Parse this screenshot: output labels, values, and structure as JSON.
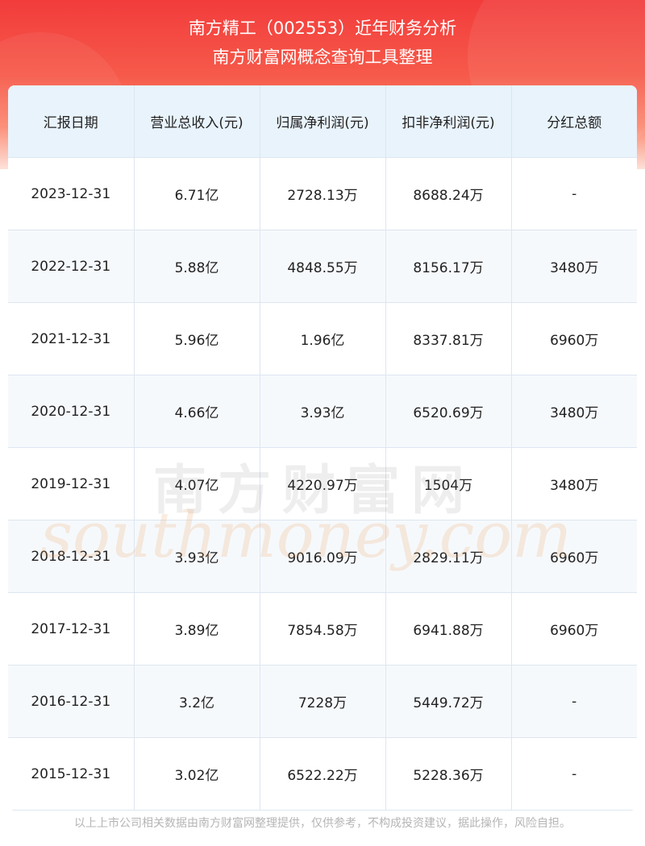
{
  "header": {
    "title_line1": "南方精工（002553）近年财务分析",
    "title_line2": "南方财富网概念查询工具整理"
  },
  "table": {
    "columns": [
      "汇报日期",
      "营业总收入(元)",
      "归属净利润(元)",
      "扣非净利润(元)",
      "分红总额"
    ],
    "rows": [
      [
        "2023-12-31",
        "6.71亿",
        "2728.13万",
        "8688.24万",
        "-"
      ],
      [
        "2022-12-31",
        "5.88亿",
        "4848.55万",
        "8156.17万",
        "3480万"
      ],
      [
        "2021-12-31",
        "5.96亿",
        "1.96亿",
        "8337.81万",
        "6960万"
      ],
      [
        "2020-12-31",
        "4.66亿",
        "3.93亿",
        "6520.69万",
        "3480万"
      ],
      [
        "2019-12-31",
        "4.07亿",
        "4220.97万",
        "1504万",
        "3480万"
      ],
      [
        "2018-12-31",
        "3.93亿",
        "9016.09万",
        "2829.11万",
        "6960万"
      ],
      [
        "2017-12-31",
        "3.89亿",
        "7854.58万",
        "6941.88万",
        "6960万"
      ],
      [
        "2016-12-31",
        "3.2亿",
        "7228万",
        "5449.72万",
        "-"
      ],
      [
        "2015-12-31",
        "3.02亿",
        "6522.22万",
        "5228.36万",
        "-"
      ]
    ]
  },
  "watermark": {
    "cn": "南方财富网",
    "en": "southmoney.com"
  },
  "footer": {
    "disclaimer": "以上上市公司相关数据由南方财富网整理提供，仅供参考，不构成投资建议，据此操作，风险自担。"
  },
  "colors": {
    "header_red": "#f23c3c",
    "table_header_bg": "#e8f3fc",
    "alt_row_bg": "#f6f9fc"
  }
}
